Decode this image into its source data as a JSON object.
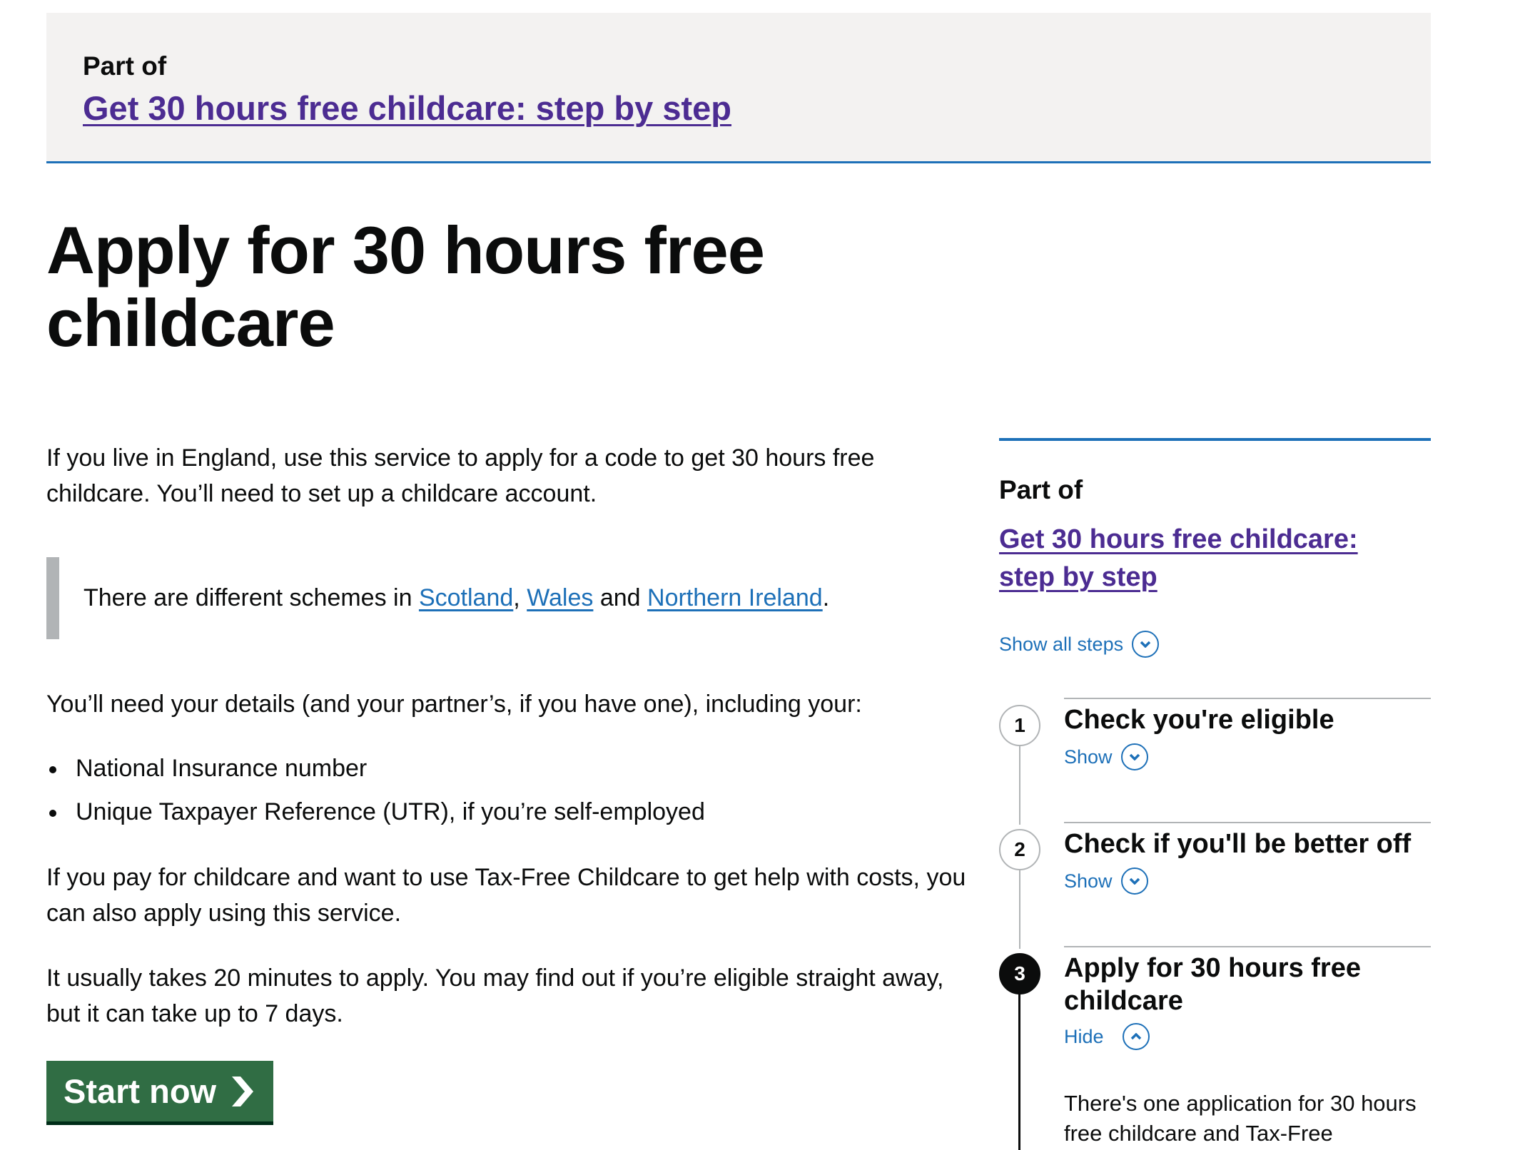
{
  "banner": {
    "part_of_label": "Part of",
    "link_text": "Get 30 hours free childcare: step by step"
  },
  "page_title": "Apply for 30 hours free childcare",
  "intro": "If you live in England, use this service to apply for a code to get 30 hours free childcare. You’ll need to set up a childcare account.",
  "inset": {
    "prefix": "There are different schemes in ",
    "links": [
      "Scotland",
      "Wales",
      "Northern Ireland"
    ],
    "sep1": ", ",
    "sep2": " and ",
    "suffix": "."
  },
  "details_intro": "You’ll need your details (and your partner’s, if you have one), including your:",
  "details_list": [
    "National Insurance number",
    "Unique Taxpayer Reference (UTR), if you’re self-employed"
  ],
  "tax_free_para": "If you pay for childcare and want to use Tax-Free Childcare to get help with costs, you can also apply using this service.",
  "timing_para": "It usually takes 20 minutes to apply. You may find out if you’re eligible straight away, but it can take up to 7 days.",
  "start_button": "Start now",
  "sidebar": {
    "part_of_label": "Part of",
    "link_text": "Get 30 hours free childcare: step by step",
    "show_all_steps": "Show all steps",
    "steps": [
      {
        "number": "1",
        "title": "Check you're eligible",
        "toggle": "Show",
        "state": "collapsed"
      },
      {
        "number": "2",
        "title": "Check if you'll be better off",
        "toggle": "Show",
        "state": "collapsed"
      },
      {
        "number": "3",
        "title": "Apply for 30 hours free childcare",
        "toggle": "Hide",
        "state": "expanded",
        "description": "There's one application for 30 hours free childcare and Tax-Free"
      }
    ]
  },
  "colors": {
    "link_visited": "#4c2c92",
    "link": "#1d70b8",
    "button_green": "#306d44",
    "banner_bg": "#f3f2f1",
    "border_blue": "#1d70b8"
  }
}
